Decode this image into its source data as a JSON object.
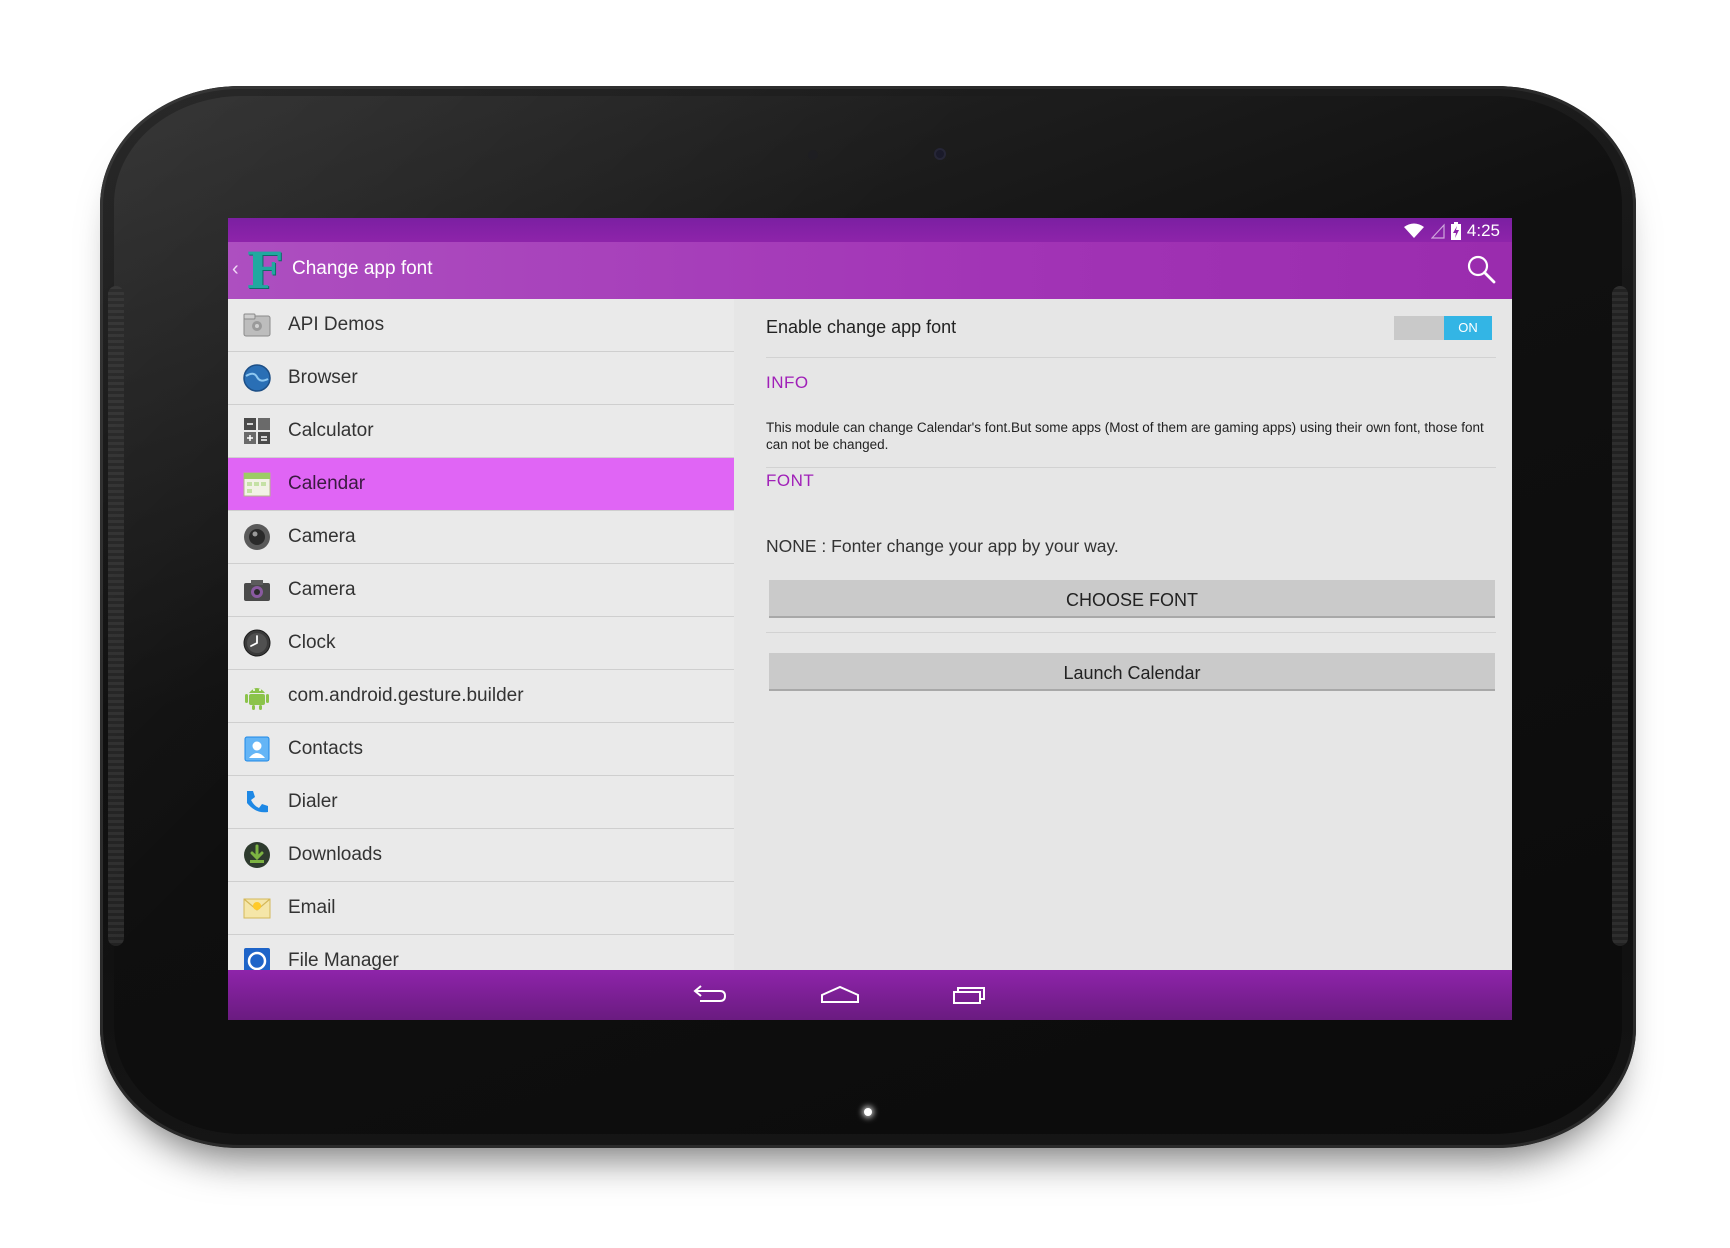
{
  "status_bar": {
    "time": "4:25",
    "icons": [
      "wifi-icon",
      "signal-icon",
      "battery-charging-icon"
    ]
  },
  "action_bar": {
    "up_icon": "chevron-left-icon",
    "logo_letter": "F",
    "title": "Change app font",
    "search_icon": "search-icon"
  },
  "app_list": {
    "selected": "Calendar",
    "items": [
      {
        "label": "API Demos",
        "icon": "folder-gear-icon"
      },
      {
        "label": "Browser",
        "icon": "globe-icon"
      },
      {
        "label": "Calculator",
        "icon": "calculator-icon"
      },
      {
        "label": "Calendar",
        "icon": "calendar-icon"
      },
      {
        "label": "Camera",
        "icon": "camera-lens-icon"
      },
      {
        "label": "Camera",
        "icon": "camera-icon"
      },
      {
        "label": "Clock",
        "icon": "clock-icon"
      },
      {
        "label": "com.android.gesture.builder",
        "icon": "android-icon"
      },
      {
        "label": "Contacts",
        "icon": "contacts-icon"
      },
      {
        "label": "Dialer",
        "icon": "phone-icon"
      },
      {
        "label": "Downloads",
        "icon": "download-icon"
      },
      {
        "label": "Email",
        "icon": "email-icon"
      },
      {
        "label": "File Manager",
        "icon": "file-manager-icon"
      }
    ]
  },
  "detail": {
    "enable_label": "Enable change app font",
    "toggle_state": "ON",
    "info_heading": "INFO",
    "info_text": "This module can change  Calendar's font.But some apps (Most of them are gaming apps) using their own font, those font can not be changed.",
    "font_heading": "FONT",
    "font_description": "NONE : Fonter change your app by your way.",
    "choose_font_button": "CHOOSE FONT",
    "launch_button": "Launch Calendar"
  },
  "nav_bar": {
    "back_icon": "back-icon",
    "home_icon": "home-icon",
    "recents_icon": "recents-icon"
  },
  "colors": {
    "status_bar": "#8e24aa",
    "action_bar": "#a234b6",
    "selected_item": "#e065f5",
    "section_heading": "#a020b8",
    "toggle_on": "#33b5e5",
    "logo": "#20a8a0"
  }
}
